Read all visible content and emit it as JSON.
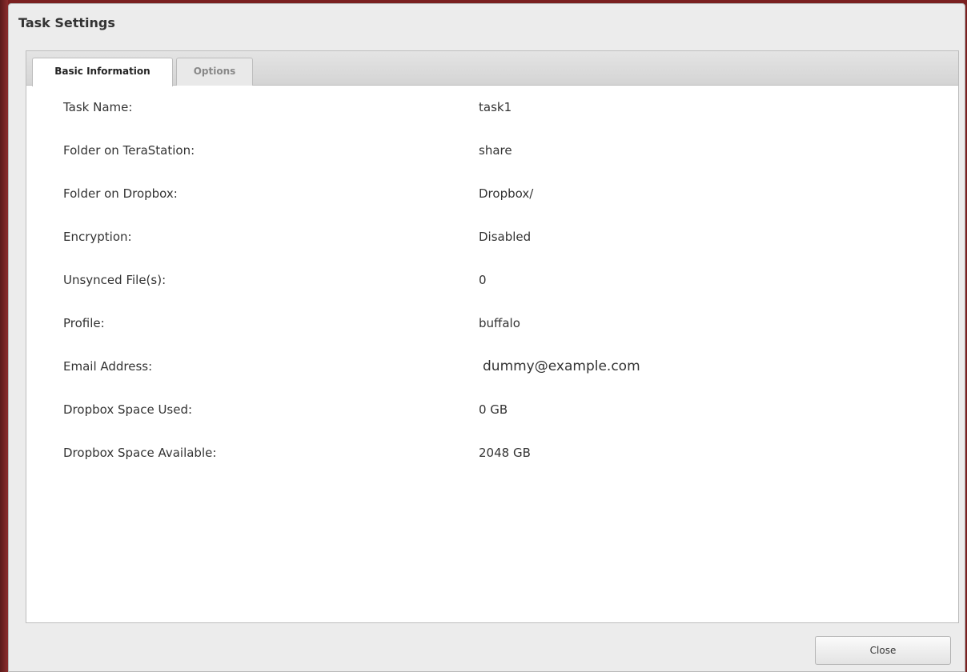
{
  "dialog": {
    "title": "Task Settings"
  },
  "tabs": [
    {
      "label": "Basic Information",
      "active": true
    },
    {
      "label": "Options",
      "active": false
    }
  ],
  "fields": [
    {
      "label": "Task Name:",
      "value": "task1"
    },
    {
      "label": "Folder on TeraStation:",
      "value": "share"
    },
    {
      "label": "Folder on Dropbox:",
      "value": "Dropbox/"
    },
    {
      "label": "Encryption:",
      "value": "Disabled"
    },
    {
      "label": "Unsynced File(s):",
      "value": "0"
    },
    {
      "label": "Profile:",
      "value": "buffalo"
    },
    {
      "label": "Email Address:",
      "value": "dummy@example.com"
    },
    {
      "label": "Dropbox Space Used:",
      "value": "0 GB"
    },
    {
      "label": "Dropbox Space Available:",
      "value": "2048 GB"
    }
  ],
  "footer": {
    "close_label": "Close"
  }
}
